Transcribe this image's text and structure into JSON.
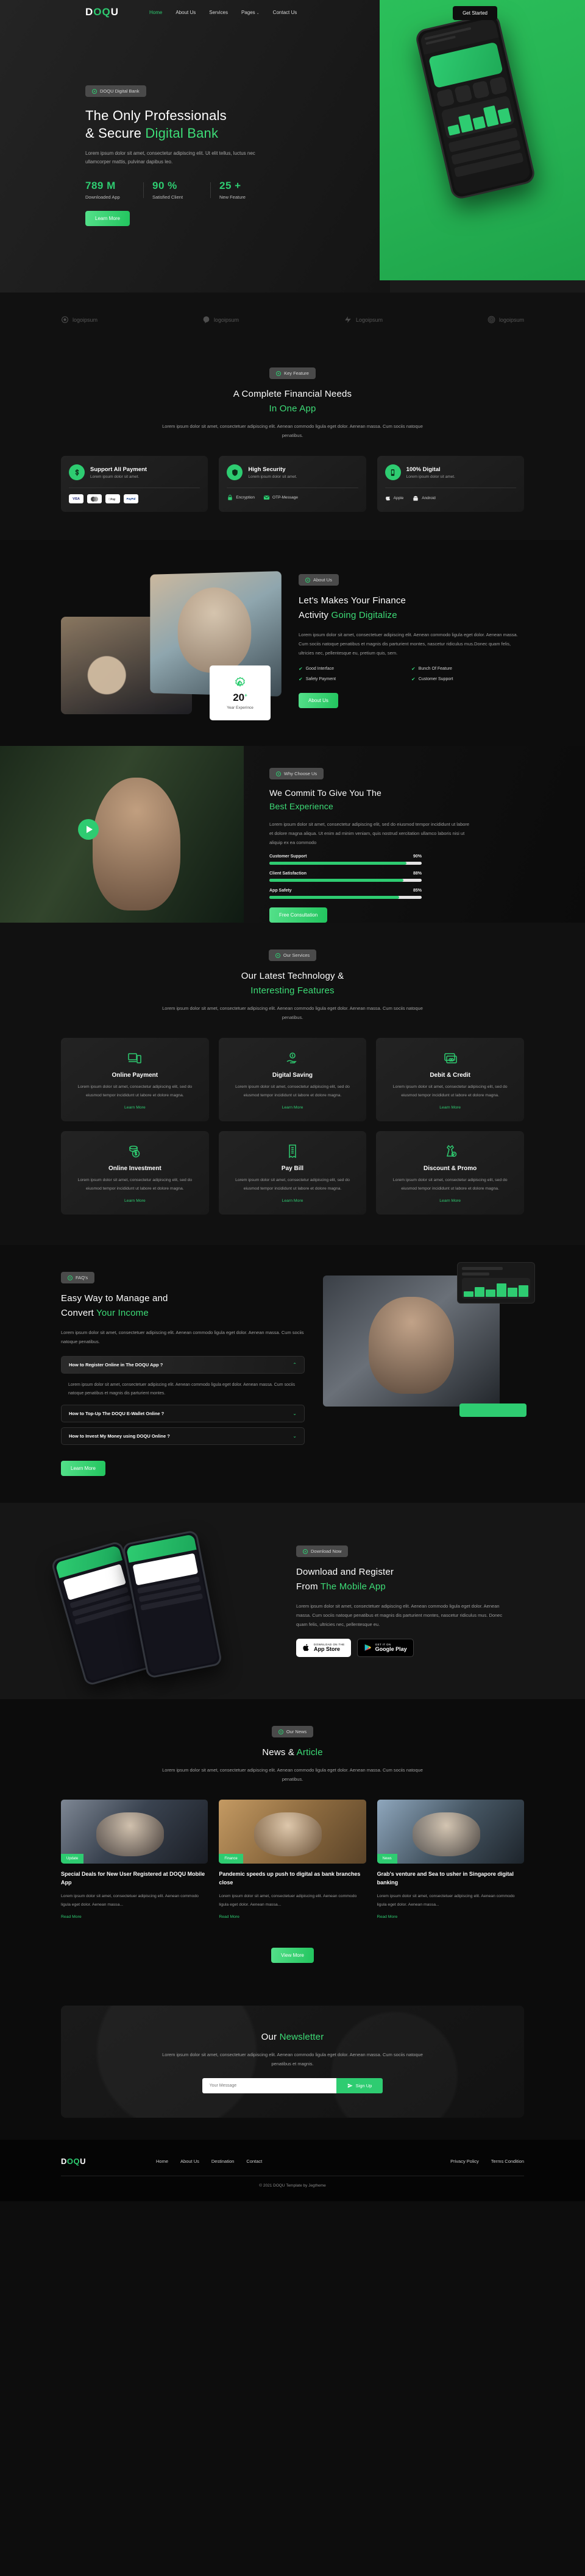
{
  "brand": {
    "name_part1": "D",
    "name_part2": "OQ",
    "name_part3": "U",
    "accent": "#2ecc71"
  },
  "header": {
    "nav": [
      {
        "label": "Home",
        "active": true
      },
      {
        "label": "About Us",
        "active": false
      },
      {
        "label": "Services",
        "active": false
      },
      {
        "label": "Pages",
        "active": false,
        "caret": "⌄"
      },
      {
        "label": "Contact Us",
        "active": false
      }
    ],
    "cta": "Get Started"
  },
  "hero": {
    "badge": "DOQU Digital Bank",
    "title_l1": "The Only Professionals",
    "title_l2a": "& Secure ",
    "title_l2b": "Digital Bank",
    "paragraph": "Lorem ipsum dolor sit amet, consectetur adipiscing elit. Ut elit tellus, luctus nec ullamcorper mattis, pulvinar dapibus leo.",
    "stats": [
      {
        "num": "789 M",
        "label": "Downloaded App"
      },
      {
        "num": "90 %",
        "label": "Satisfied Client"
      },
      {
        "num": "25 +",
        "label": "New Feature"
      }
    ],
    "button": "Learn More"
  },
  "logos": [
    {
      "name": "logoipsum"
    },
    {
      "name": "logoipsum"
    },
    {
      "name": "Logoipsum"
    },
    {
      "name": "logoipsum"
    }
  ],
  "key_feature": {
    "badge": "Key Feature",
    "title_l1": "A Complete Financial Needs",
    "title_l2": "In One App",
    "paragraph": "Lorem ipsum dolor sit amet, consectetuer adipiscing elit. Aenean commodo ligula eget dolor. Aenean massa. Cum sociis natoque penatibus.",
    "cards": [
      {
        "title": "Support All Payment",
        "desc": "Lorem ipsum dolor sit amet.",
        "icon": "dollar-icon",
        "chips": [
          "VISA",
          "MC",
          "Pay",
          "PayPal"
        ]
      },
      {
        "title": "High Security",
        "desc": "Lorem ipsum dolor sit amet.",
        "icon": "shield-icon",
        "minis": [
          "Encryption",
          "OTP-Message"
        ]
      },
      {
        "title": "100% Digital",
        "desc": "Lorem ipsum dolor sit amet.",
        "icon": "mobile-icon",
        "minis": [
          "Apple",
          "Android"
        ]
      }
    ]
  },
  "about": {
    "badge": "About Us",
    "title_l1": "Let's Makes Your Finance",
    "title_l2a": "Activity ",
    "title_l2b": "Going Digitalize",
    "paragraph": "Lorem ipsum dolor sit amet, consectetuer adipiscing elit. Aenean commodo ligula eget dolor. Aenean massa. Cum sociis natoque penatibus et magnis dis parturient montes, nascetur ridiculus mus.Donec quam felis, ultricies nec, pellentesque eu, pretium quis, sem.",
    "checks": [
      "Good Interface",
      "Bunch Of Feature",
      "Safety Payment",
      "Customer Support"
    ],
    "button": "About Us",
    "years_num": "20",
    "years_sup": "+",
    "years_label": "Year Experince"
  },
  "why": {
    "badge": "Why Choose Us",
    "title_l1": "We Commit To Give You The",
    "title_l2": "Best Experience",
    "paragraph": "Lorem ipsum dolor sit amet, consectetur adipiscing elit, sed do eiusmod tempor incididunt ut labore et dolore magna aliqua. Ut enim ad minim veniam, quis nostrud xercitation ullamco laboris nisi ut aliquip ex ea commodo",
    "bars": [
      {
        "label": "Customer Support",
        "value": "90%",
        "pct": 90
      },
      {
        "label": "Client Satisfaction",
        "value": "88%",
        "pct": 88
      },
      {
        "label": "App Safety",
        "value": "85%",
        "pct": 85
      }
    ],
    "button": "Free Consultation"
  },
  "services": {
    "badge": "Our Services",
    "title_l1": "Our Latest Technology &",
    "title_l2": "Interesting Features",
    "paragraph": "Lorem ipsum dolor sit amet, consectetuer adipiscing elit. Aenean commodo ligula eget dolor. Aenean massa. Cum sociis natoque penatibus.",
    "link": "Learn More",
    "cards": [
      {
        "title": "Online Payment",
        "icon": "devices-icon",
        "desc": "Lorem ipsum dolor sit amet, consectetur adipiscing elit, sed do eiusmod tempor incididunt ut labore et dolore magna."
      },
      {
        "title": "Digital Saving",
        "icon": "hand-coin-icon",
        "desc": "Lorem ipsum dolor sit amet, consectetur adipiscing elit, sed do eiusmod tempor incididunt ut labore et dolore magna."
      },
      {
        "title": "Debit & Credit",
        "icon": "cards-icon",
        "desc": "Lorem ipsum dolor sit amet, consectetur adipiscing elit, sed do eiusmod tempor incididunt ut labore et dolore magna."
      },
      {
        "title": "Online Investment",
        "icon": "coins-icon",
        "desc": "Lorem ipsum dolor sit amet, consectetur adipiscing elit, sed do eiusmod tempor incididunt ut labore et dolore magna."
      },
      {
        "title": "Pay Bill",
        "icon": "receipt-icon",
        "desc": "Lorem ipsum dolor sit amet, consectetur adipiscing elit, sed do eiusmod tempor incididunt ut labore et dolore magna."
      },
      {
        "title": "Discount & Promo",
        "icon": "dress-tag-icon",
        "desc": "Lorem ipsum dolor sit amet, consectetur adipiscing elit, sed do eiusmod tempor incididunt ut labore et dolore magna."
      }
    ]
  },
  "faq": {
    "badge": "FAQ's",
    "title_l1": "Easy Way to Manage and",
    "title_l2a": "Convert ",
    "title_l2b": "Your Income",
    "paragraph": "Lorem ipsum dolor sit amet, consectetuer adipiscing elit. Aenean commodo ligula eget dolor. Aenean massa. Cum sociis natoque penatibus.",
    "items": [
      {
        "q": "How to Register Online in The DOQU App ?",
        "open": true,
        "arrow": "⌃",
        "a": "Lorem ipsum dolor sit amet, consectetuer adipiscing elit. Aenean commodo ligula eget dolor. Aenean massa. Cum sociis natoque penatibus et magnis dis parturient montes."
      },
      {
        "q": "How to Top-Up The DOQU E-Wallet Online ?",
        "open": false,
        "arrow": "⌄",
        "a": ""
      },
      {
        "q": "How to Invest My Money using DOQU Online ?",
        "open": false,
        "arrow": "⌄",
        "a": ""
      }
    ],
    "button": "Learn More"
  },
  "download": {
    "badge": "Download Now",
    "title_l1": "Download and Register",
    "title_l2a": "From ",
    "title_l2b": "The Mobile App",
    "paragraph": "Lorem ipsum dolor sit amet, consectetuer adipiscing elit. Aenean commodo ligula eget dolor. Aenean massa. Cum sociis natoque penatibus et magnis dis parturient montes, nascetur ridiculus mus. Donec quam felis, ultricies nec, pellentesque eu.",
    "stores": [
      {
        "small": "Download on the",
        "big": "App Store",
        "icon": "apple-icon"
      },
      {
        "small": "Get it on",
        "big": "Google Play",
        "icon": "play-icon"
      }
    ]
  },
  "news": {
    "badge": "Our News",
    "title_l1": "News & ",
    "title_l2": "Article",
    "paragraph": "Lorem ipsum dolor sit amet, consectetuer adipiscing elit. Aenean commodo ligula eget dolor. Aenean massa. Cum sociis natoque penatibus.",
    "read_more": "Read More",
    "view_more": "View More",
    "cards": [
      {
        "tag": "Update",
        "title": "Special Deals for New User Registered at DOQU Mobile App",
        "desc": "Lorem ipsum dolor sit amet, consectetuer adipiscing elit. Aenean commodo ligula eget dolor. Aenean massa..."
      },
      {
        "tag": "Finance",
        "title": "Pandemic speeds up push to digital as bank branches close",
        "desc": "Lorem ipsum dolor sit amet, consectetuer adipiscing elit. Aenean commodo ligula eget dolor. Aenean massa..."
      },
      {
        "tag": "News",
        "title": "Grab's venture and Sea to usher in Singapore digital banking",
        "desc": "Lorem ipsum dolor sit amet, consectetuer adipiscing elit. Aenean commodo ligula eget dolor. Aenean massa..."
      }
    ]
  },
  "newsletter": {
    "title_l1": "Our ",
    "title_l2": "Newsletter",
    "paragraph": "Lorem ipsum dolor sit amet, consectetuer adipiscing elit. Aenean commodo ligula eget dolor. Aenean massa. Cum sociis natoque penatibus et magnis.",
    "placeholder": "Your Message",
    "button": "Sign Up"
  },
  "footer": {
    "nav_left": [
      "Home",
      "About Us",
      "Destination",
      "Contact"
    ],
    "nav_right": [
      "Privacy Policy",
      "Terms Condition"
    ],
    "copyright": "© 2021 DOQU Template by Jegtheme"
  }
}
